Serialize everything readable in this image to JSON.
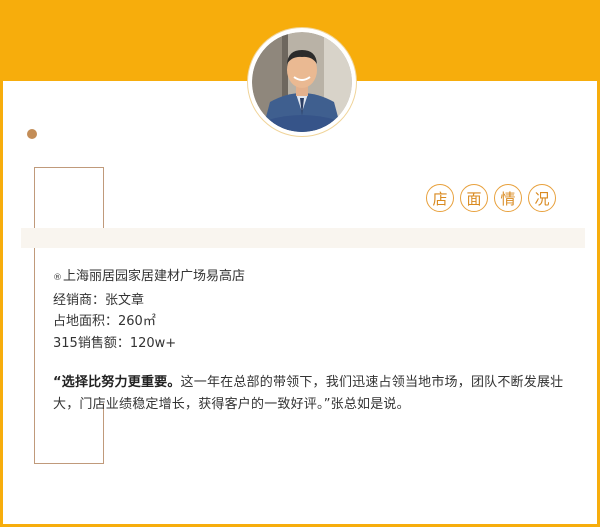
{
  "header": {
    "accent_color": "#f7ad0c",
    "avatar_alt": "avatar"
  },
  "section": {
    "title_chars": [
      "店",
      "面",
      "情",
      "况"
    ],
    "title_color": "#d98a20"
  },
  "store": {
    "marker": "®",
    "name": "上海丽居园家居建材广场易高店",
    "dealer_line": "经销商：张文章",
    "area_line": "占地面积：260㎡",
    "sales_line": "315销售额：120w+"
  },
  "quote": {
    "bold": "“选择比努力更重要。",
    "rest": "这一年在总部的带领下，我们迅速占领当地市场，团队不断发展壮大，门店业绩稳定增长，获得客户的一致好评。”张总如是说。"
  }
}
